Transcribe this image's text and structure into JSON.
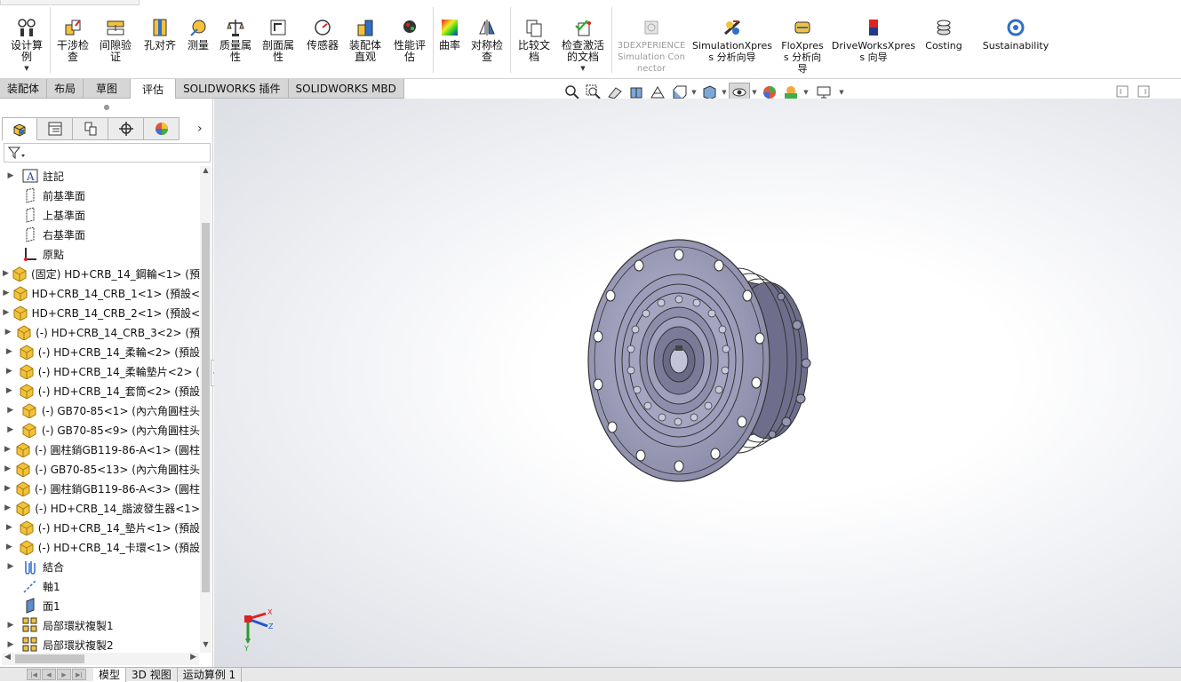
{
  "ribbon": {
    "buttons": [
      {
        "label": "设计算例"
      },
      {
        "label": "干涉检查"
      },
      {
        "label": "间隙验证"
      },
      {
        "label": "孔对齐"
      },
      {
        "label": "测量"
      },
      {
        "label": "质量属性"
      },
      {
        "label": "剖面属性"
      },
      {
        "label": "传感器"
      },
      {
        "label": "装配体直观"
      },
      {
        "label": "性能评估"
      },
      {
        "label": "曲率"
      },
      {
        "label": "对称检查"
      },
      {
        "label": "比较文档"
      },
      {
        "label": "检查激活的文档"
      },
      {
        "label": "3DEXPERIENCE Simulation Connector"
      },
      {
        "label": "SimulationXpress 分析向导"
      },
      {
        "label": "FloXpress 分析向导"
      },
      {
        "label": "DriveWorksXpress 向导"
      },
      {
        "label": "Costing"
      },
      {
        "label": "Sustainability"
      }
    ]
  },
  "command_tabs": [
    "装配体",
    "布局",
    "草图",
    "评估",
    "SOLIDWORKS 插件",
    "SOLIDWORKS MBD"
  ],
  "feature_tree": {
    "items": [
      {
        "label": "註記",
        "icon": "annotation-icon"
      },
      {
        "label": "前基準面",
        "icon": "plane-icon"
      },
      {
        "label": "上基準面",
        "icon": "plane-icon"
      },
      {
        "label": "右基準面",
        "icon": "plane-icon"
      },
      {
        "label": "原點",
        "icon": "origin-icon"
      },
      {
        "label": "(固定) HD+CRB_14_鋼輪<1> (預",
        "icon": "part-icon"
      },
      {
        "label": "HD+CRB_14_CRB_1<1> (預設<",
        "icon": "part-icon"
      },
      {
        "label": "HD+CRB_14_CRB_2<1> (預設<",
        "icon": "part-icon"
      },
      {
        "label": "(-) HD+CRB_14_CRB_3<2> (預",
        "icon": "part-icon"
      },
      {
        "label": "(-) HD+CRB_14_柔輪<2> (預設",
        "icon": "part-icon"
      },
      {
        "label": "(-) HD+CRB_14_柔輪墊片<2> (",
        "icon": "part-icon"
      },
      {
        "label": "(-) HD+CRB_14_套筒<2> (預設",
        "icon": "part-icon"
      },
      {
        "label": "(-) GB70-85<1> (內六角圓柱头",
        "icon": "part-icon"
      },
      {
        "label": "(-) GB70-85<9> (內六角圓柱头",
        "icon": "part-icon"
      },
      {
        "label": "(-) 圓柱銷GB119-86-A<1> (圓柱",
        "icon": "part-icon"
      },
      {
        "label": "(-) GB70-85<13> (內六角圓柱头",
        "icon": "part-icon"
      },
      {
        "label": "(-) 圓柱銷GB119-86-A<3> (圓柱",
        "icon": "part-icon"
      },
      {
        "label": "(-) HD+CRB_14_諧波發生器<1>",
        "icon": "part-icon"
      },
      {
        "label": "(-) HD+CRB_14_墊片<1> (預設",
        "icon": "part-icon"
      },
      {
        "label": "(-) HD+CRB_14_卡環<1> (預設",
        "icon": "part-icon"
      },
      {
        "label": "結合",
        "icon": "mates-icon"
      },
      {
        "label": "軸1",
        "icon": "axis-icon"
      },
      {
        "label": "面1",
        "icon": "face-plane-icon"
      },
      {
        "label": "局部環狀複製1",
        "icon": "pattern-icon"
      },
      {
        "label": "局部環狀複製2",
        "icon": "pattern-icon"
      }
    ]
  },
  "bottom_tabs": [
    "模型",
    "3D 视图",
    "运动算例 1"
  ],
  "triad": {
    "x": "X",
    "y": "Y",
    "z": "Z"
  },
  "colors": {
    "accent": "#2f6fc7",
    "part_yellow": "#f2c23a",
    "model_metal": "#8f8fb0"
  }
}
